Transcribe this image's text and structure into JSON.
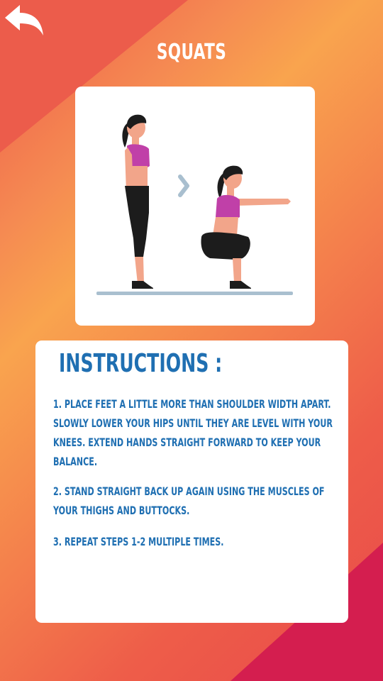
{
  "screen": {
    "title": "SQUATS"
  },
  "back_button": {
    "icon": "back-arrow-icon"
  },
  "illustration": {
    "description_icon": "squat-exercise-illustration",
    "arrow_icon": "chevron-right-icon",
    "colors": {
      "top": "#c040a8",
      "leggings": "#1c1c1c",
      "skin": "#f2a58a",
      "hair": "#1c1c1c",
      "floor": "#a9bfcf",
      "chevron": "#a9bfcf"
    }
  },
  "instructions": {
    "heading": "INSTRUCTIONS :",
    "steps": [
      "1. PLACE FEET A LITTLE MORE THAN SHOULDER WIDTH APART. SLOWLY LOWER YOUR HIPS UNTIL THEY ARE LEVEL WITH YOUR KNEES. EXTEND HANDS STRAIGHT FORWARD TO KEEP YOUR BALANCE.",
      "2. STAND STRAIGHT BACK UP AGAIN USING THE MUSCLES OF YOUR THIGHS AND BUTTOCKS.",
      "3. REPEAT STEPS 1-2 MULTIPLE TIMES."
    ]
  },
  "theme": {
    "accent_text": "#1f6fb2",
    "background_orange": "#f9a44e",
    "background_red": "#ee5a4a",
    "corner_magenta": "#d41e4f"
  }
}
